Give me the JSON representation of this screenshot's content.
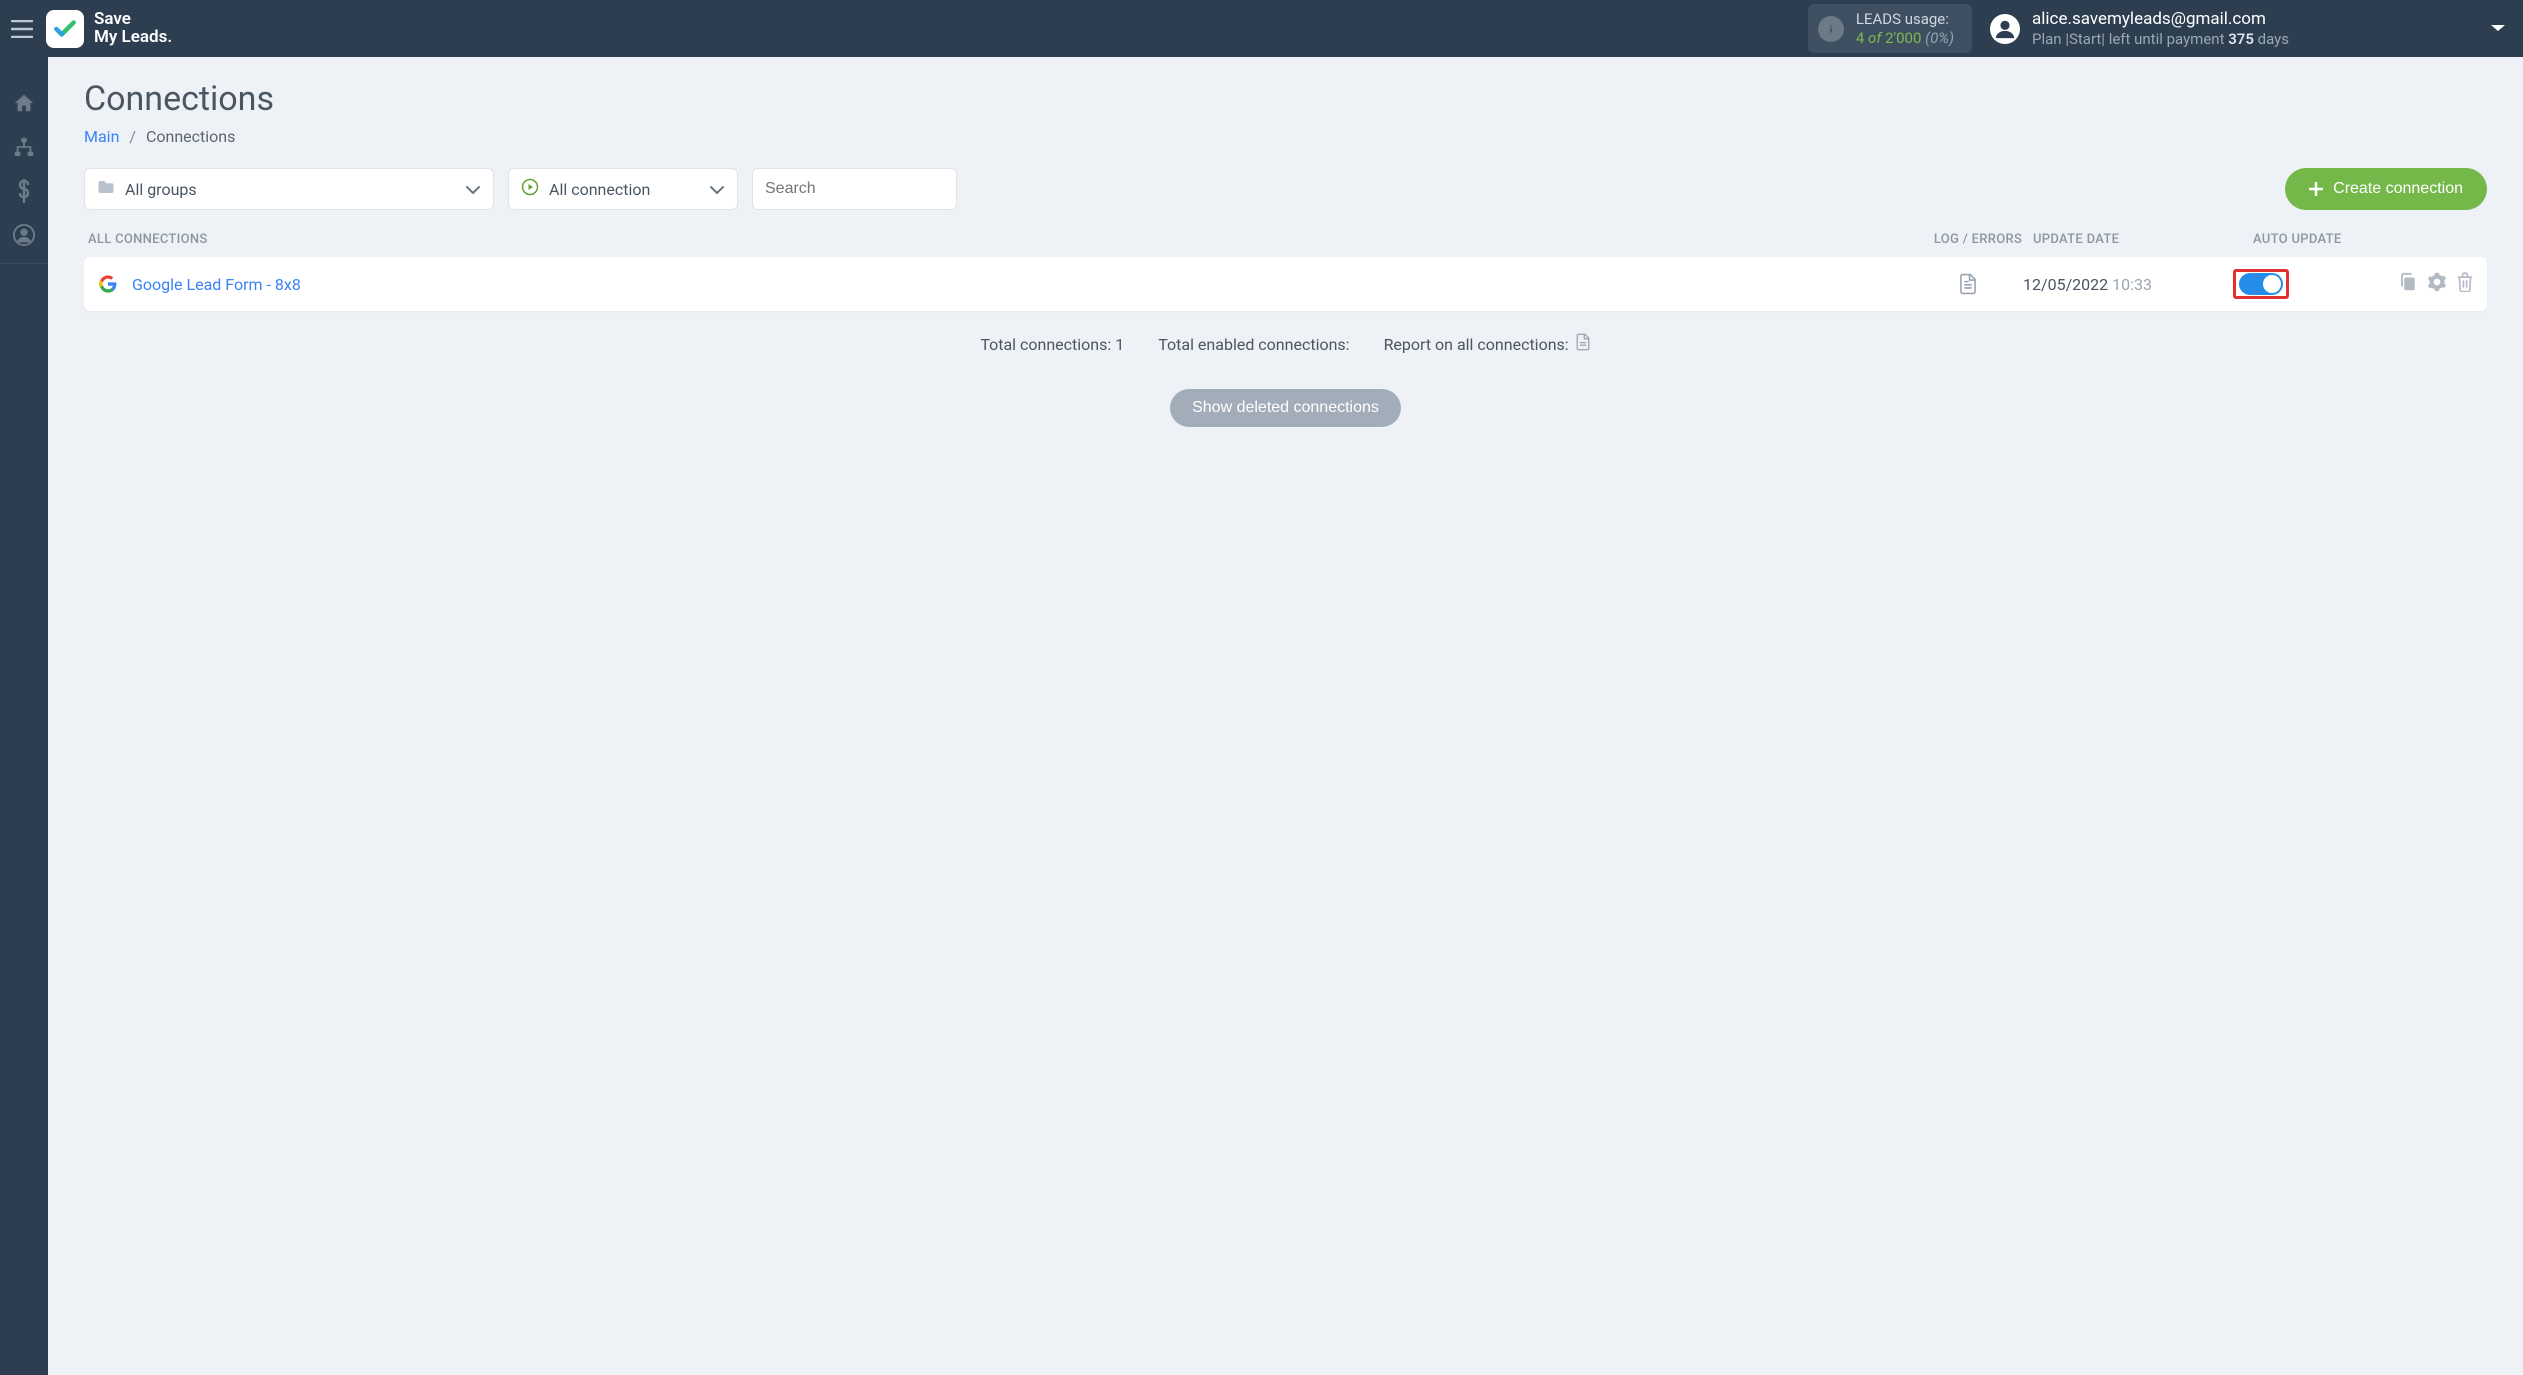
{
  "brand": {
    "line1": "Save",
    "line2": "My Leads."
  },
  "header": {
    "leads_usage_label": "LEADS usage:",
    "leads_used": "4",
    "leads_of": "of",
    "leads_total": "2'000",
    "leads_pct": "(0%)",
    "account_email": "alice.savemyleads@gmail.com",
    "plan_prefix": "Plan ",
    "plan_name": "|Start|",
    "plan_mid": " left until payment ",
    "plan_days": "375",
    "plan_suffix": " days"
  },
  "page": {
    "title": "Connections",
    "breadcrumb_main": "Main",
    "breadcrumb_current": "Connections"
  },
  "filters": {
    "groups_label": "All groups",
    "connection_label": "All connection",
    "search_placeholder": "Search"
  },
  "buttons": {
    "create": "Create connection",
    "show_deleted": "Show deleted connections"
  },
  "table": {
    "header_all": "All connections",
    "header_log": "Log / Errors",
    "header_update": "Update date",
    "header_auto": "Auto update"
  },
  "rows": [
    {
      "name": "Google Lead Form - 8x8",
      "date": "12/05/2022",
      "time": "10:33",
      "auto_update": true
    }
  ],
  "summary": {
    "total_connections_label": "Total connections: ",
    "total_connections_value": "1",
    "total_enabled_label": "Total enabled connections:",
    "report_label": "Report on all connections:"
  }
}
